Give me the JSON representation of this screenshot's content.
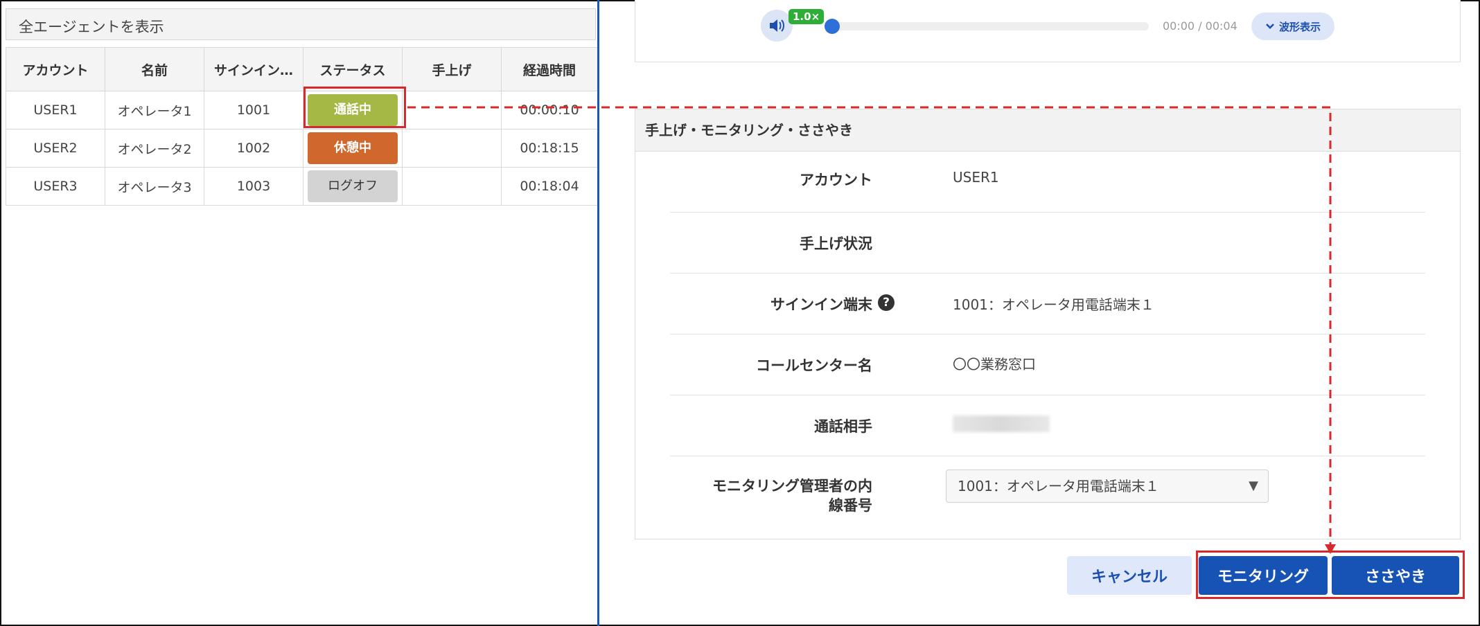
{
  "left_panel": {
    "filter_label": "全エージェントを表示",
    "columns": [
      "アカウント",
      "名前",
      "サインイン…",
      "ステータス",
      "手上げ",
      "経過時間"
    ],
    "rows": [
      {
        "account": "USER1",
        "name": "オペレータ1",
        "signin": "1001",
        "status": "通話中",
        "raise": "",
        "elapsed": "00:00:10"
      },
      {
        "account": "USER2",
        "name": "オペレータ2",
        "signin": "1002",
        "status": "休憩中",
        "raise": "",
        "elapsed": "00:18:15"
      },
      {
        "account": "USER3",
        "name": "オペレータ3",
        "signin": "1003",
        "status": "ログオフ",
        "raise": "",
        "elapsed": "00:18:04"
      }
    ]
  },
  "player": {
    "speed": "1.0×",
    "time": "00:00 / 00:04",
    "wave_label": "波形表示",
    "progress": 0
  },
  "detail": {
    "title": "手上げ・モニタリング・ささやき",
    "account_label": "アカウント",
    "account_value": "USER1",
    "raise_label": "手上げ状況",
    "raise_value": "",
    "terminal_label": "サインイン端末",
    "terminal_value": "1001：オペレータ用電話端末１",
    "center_label": "コールセンター名",
    "center_value": "〇〇業務窓口",
    "partner_label": "通話相手",
    "extension_label_line1": "モニタリング管理者の内",
    "extension_label_line2": "線番号",
    "extension_value": "1001：オペレータ用電話端末１"
  },
  "buttons": {
    "cancel": "キャンセル",
    "monitoring": "モニタリング",
    "whisper": "ささやき"
  },
  "colors": {
    "accent": "#1653b4",
    "status_call": "#a5b845",
    "status_rest": "#d0672d",
    "status_off": "#d3d3d3",
    "annotation": "#d9282b"
  }
}
